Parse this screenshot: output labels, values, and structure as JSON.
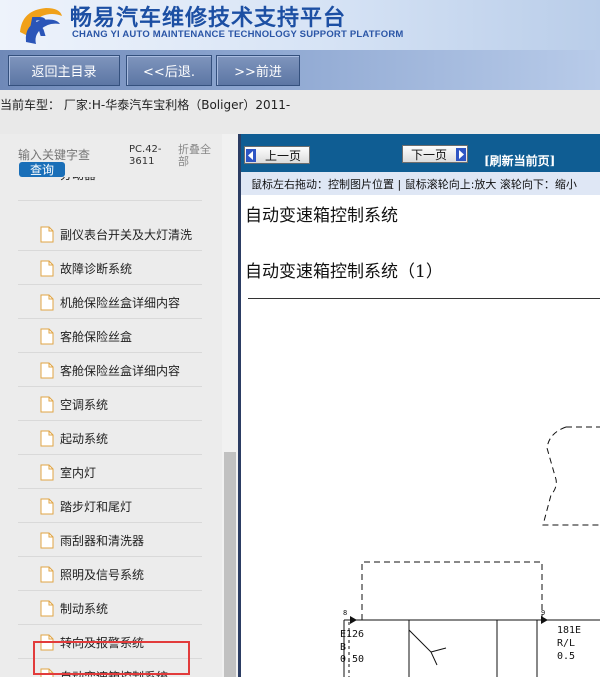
{
  "header": {
    "title": "畅易汽车维修技术支持平台",
    "subtitle": "CHANG YI AUTO MAINTENANCE TECHNOLOGY SUPPORT PLATFORM"
  },
  "nav": {
    "home": "返回主目录",
    "back": "<<后退.",
    "forward": ">>前进"
  },
  "car_line": "当前车型： 厂家:H-华泰汽车宝利格（Boliger）2011-",
  "sidebar": {
    "search_placeholder": "输入关键字查",
    "search_button": "查询",
    "model_code": "PC.42-3611",
    "collapse_all": "折叠全部",
    "items": [
      {
        "label": "分动器"
      },
      {
        "label": "副仪表台开关及大灯清洗"
      },
      {
        "label": "故障诊断系统"
      },
      {
        "label": "机舱保险丝盒详细内容"
      },
      {
        "label": "客舱保险丝盒"
      },
      {
        "label": "客舱保险丝盒详细内容"
      },
      {
        "label": "空调系统"
      },
      {
        "label": "起动系统"
      },
      {
        "label": "室内灯"
      },
      {
        "label": "踏步灯和尾灯"
      },
      {
        "label": "雨刮器和清洗器"
      },
      {
        "label": "照明及信号系统"
      },
      {
        "label": "制动系统"
      },
      {
        "label": "转向及报警系统"
      },
      {
        "label": "自动变速箱控制系统"
      }
    ],
    "selected_index": 14
  },
  "viewer": {
    "prev_page": "上一页",
    "next_page": "下一页",
    "refresh": "[刷新当前页]",
    "hint": "鼠标左右拖动：控制图片位置 | 鼠标滚轮向上:放大  滚轮向下：缩小",
    "title": "自动变速箱控制系统",
    "subtitle": "自动变速箱控制系统（1）",
    "diagram": {
      "left_code": "E126",
      "left_b": "B",
      "left_wire": "0.50",
      "right_code": "181E",
      "right_wire_color": "R/L",
      "right_wire": "0.5",
      "left_connector": "8",
      "right_connector": "9"
    }
  },
  "colors": {
    "toolbar": "#0f5d93",
    "brand": "#1c4fa3",
    "highlight": "#e23b3b",
    "search_button": "#1a6fb8"
  }
}
